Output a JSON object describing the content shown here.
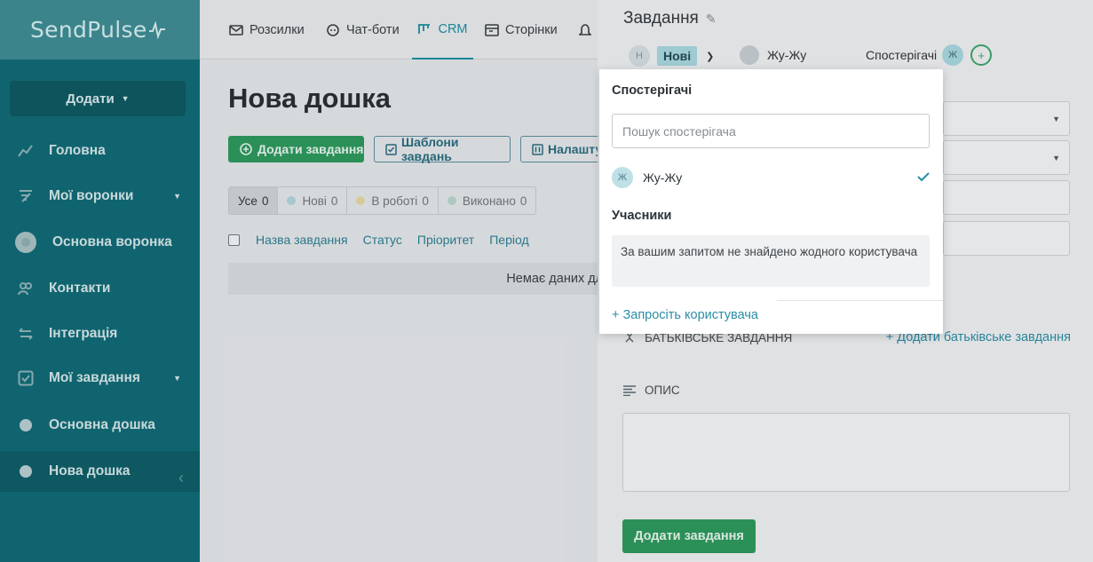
{
  "app": {
    "logo": "SendPulse"
  },
  "sidebar": {
    "add_button": "Додати",
    "items": [
      {
        "label": "Головна"
      },
      {
        "label": "Мої воронки"
      },
      {
        "label": "Основна воронка"
      },
      {
        "label": "Контакти"
      },
      {
        "label": "Інтеграція"
      },
      {
        "label": "Мої завдання"
      },
      {
        "label": "Основна дошка"
      },
      {
        "label": "Нова дошка"
      }
    ]
  },
  "topnav": {
    "tabs": [
      {
        "label": "Розсилки"
      },
      {
        "label": "Чат-боти"
      },
      {
        "label": "CRM"
      },
      {
        "label": "Сторінки"
      }
    ]
  },
  "board": {
    "title": "Нова дошка",
    "add_task": "Додати завдання",
    "templates": "Шаблони завдань",
    "settings": "Налашту",
    "filters": [
      {
        "label": "Усе",
        "count": "0"
      },
      {
        "label": "Нові",
        "count": "0"
      },
      {
        "label": "В роботі",
        "count": "0"
      },
      {
        "label": "Виконано",
        "count": "0"
      }
    ],
    "columns": [
      "Назва завдання",
      "Статус",
      "Пріоритет",
      "Період"
    ],
    "no_data": "Немає даних для"
  },
  "task_panel": {
    "title": "Завдання",
    "status_avatar": "Н",
    "status": "Нові",
    "assignee": "Жу-Жу",
    "watchers_label": "Спостерігачі",
    "watcher_avatar": "Ж",
    "add_watcher": "+",
    "parent_label": "БАТЬКІВСЬКЕ ЗАВДАННЯ",
    "add_parent": "+ Додати батьківське завдання",
    "description_label": "ОПИС",
    "submit": "Додати завдання"
  },
  "watchers_popup": {
    "title": "Спостерігачі",
    "search_placeholder": "Пошук спостерігача",
    "user_avatar": "Ж",
    "user_name": "Жу-Жу",
    "participants_title": "Учасники",
    "empty_message": "За вашим запитом не знайдено жодного користувача",
    "invite": "+ Запросіть користувача"
  },
  "colors": {
    "brand": "#126b76",
    "accent": "#1b8fa0",
    "green": "#2e9a5e"
  }
}
